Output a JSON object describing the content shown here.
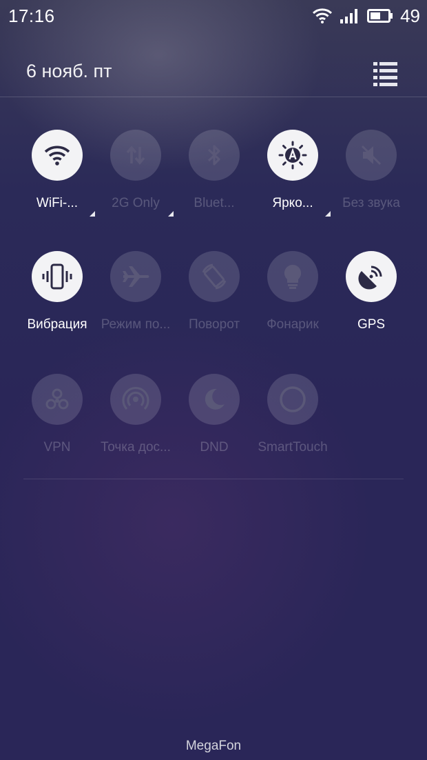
{
  "status_bar": {
    "time": "17:16",
    "battery_level": "49",
    "icons": [
      "wifi-icon",
      "signal-icon",
      "battery-icon"
    ]
  },
  "header": {
    "date": "6 нояб. пт",
    "menu_icon": "list-menu-icon"
  },
  "toggles": [
    {
      "label": "WiFi-...",
      "icon": "wifi-icon",
      "state": "on",
      "has_more": true
    },
    {
      "label": "2G Only",
      "icon": "data-transfer-icon",
      "state": "off",
      "label_active": true,
      "has_more": true
    },
    {
      "label": "Bluet...",
      "icon": "bluetooth-icon",
      "state": "off",
      "has_more": false
    },
    {
      "label": "Ярко...",
      "icon": "auto-brightness-icon",
      "state": "on",
      "has_more": true
    },
    {
      "label": "Без звука",
      "icon": "mute-icon",
      "state": "off",
      "has_more": false
    },
    {
      "label": "Вибрация",
      "icon": "vibration-icon",
      "state": "on",
      "has_more": false
    },
    {
      "label": "Режим по...",
      "icon": "airplane-icon",
      "state": "off",
      "has_more": false
    },
    {
      "label": "Поворот",
      "icon": "rotate-icon",
      "state": "off",
      "has_more": false
    },
    {
      "label": "Фонарик",
      "icon": "flashlight-icon",
      "state": "off",
      "has_more": false
    },
    {
      "label": "GPS",
      "icon": "gps-icon",
      "state": "on",
      "has_more": false
    },
    {
      "label": "VPN",
      "icon": "vpn-icon",
      "state": "off",
      "has_more": false
    },
    {
      "label": "Точка дос...",
      "icon": "hotspot-icon",
      "state": "off",
      "has_more": false
    },
    {
      "label": "DND",
      "icon": "moon-icon",
      "state": "off",
      "has_more": false
    },
    {
      "label": "SmartTouch",
      "icon": "smarttouch-icon",
      "state": "off",
      "has_more": false
    }
  ],
  "colors": {
    "tile_on": "#f3f3f5",
    "icon_on": "#2c2a45",
    "icon_off": "#5a5878"
  },
  "carrier": "MegaFon"
}
